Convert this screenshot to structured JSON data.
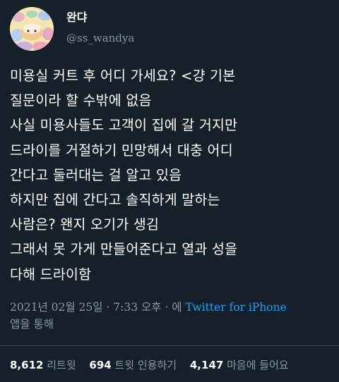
{
  "author": {
    "display_name": "완댜",
    "handle": "@ss_wandya",
    "avatar_icon": "avatar-cake-icon"
  },
  "tweet": {
    "lines": [
      "미용실 커트 후 어디 가세요? <걍 기본",
      "질문이라 할 수밖에 없음",
      "사실 미용사들도 고객이 집에 갈 거지만",
      "드라이를 거절하기 민망해서 대충 어디",
      "간다고 둘러대는 걸 알고 있음",
      "하지만 집에 간다고 솔직하게 말하는",
      "사람은? 왠지 오기가 생김",
      "그래서 못 가게 만들어준다고 열과 성을",
      "다해 드라이함"
    ]
  },
  "meta": {
    "timestamp": "2021년 02월 25일 · 7:33 오후 · 에",
    "source": "Twitter for iPhone",
    "via": "앱을 통해"
  },
  "stats": {
    "retweets_count": "8,612",
    "retweets_label": "리트윗",
    "quotes_count": "694",
    "quotes_label": "트윗 인용하기",
    "likes_count": "4,147",
    "likes_label": "마음에 들어요"
  },
  "colors": {
    "background": "#15202b",
    "secondary_text": "#8899a6",
    "link": "#1da1f2",
    "divider": "#38444d"
  }
}
